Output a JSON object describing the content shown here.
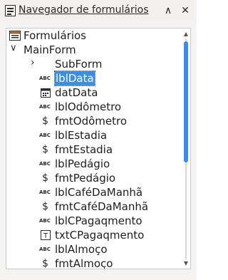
{
  "window": {
    "title": "Navegador de formulários"
  },
  "tree": {
    "root_label": "Formulários",
    "main_form_label": "MainForm",
    "subform_label": "SubForm",
    "items": [
      {
        "label": "lblData",
        "icon": "label-abc-icon"
      },
      {
        "label": "datData",
        "icon": "date-field-icon"
      },
      {
        "label": "lblOdômetro",
        "icon": "label-abc-icon"
      },
      {
        "label": "fmtOdômetro",
        "icon": "formatted-field-icon"
      },
      {
        "label": "lblEstadia",
        "icon": "label-abc-icon"
      },
      {
        "label": "fmtEstadia",
        "icon": "formatted-field-icon"
      },
      {
        "label": "lblPedágio",
        "icon": "label-abc-icon"
      },
      {
        "label": "fmtPedágio",
        "icon": "formatted-field-icon"
      },
      {
        "label": "lblCaféDaManhã",
        "icon": "label-abc-icon"
      },
      {
        "label": "fmtCaféDaManhã",
        "icon": "formatted-field-icon"
      },
      {
        "label": "lblCPagaqmento",
        "icon": "label-abc-icon"
      },
      {
        "label": "txtCPagaqmento",
        "icon": "text-box-icon"
      },
      {
        "label": "lblAlmoço",
        "icon": "label-abc-icon"
      },
      {
        "label": "fmtAlmoço",
        "icon": "formatted-field-icon"
      }
    ],
    "abc_glyph": "ABC",
    "currency_glyph": "$",
    "text_glyph": "T",
    "selected_label": "lblData"
  },
  "colors": {
    "selection": "#3a8ee6",
    "scrollbar": "#3a8ee6"
  }
}
